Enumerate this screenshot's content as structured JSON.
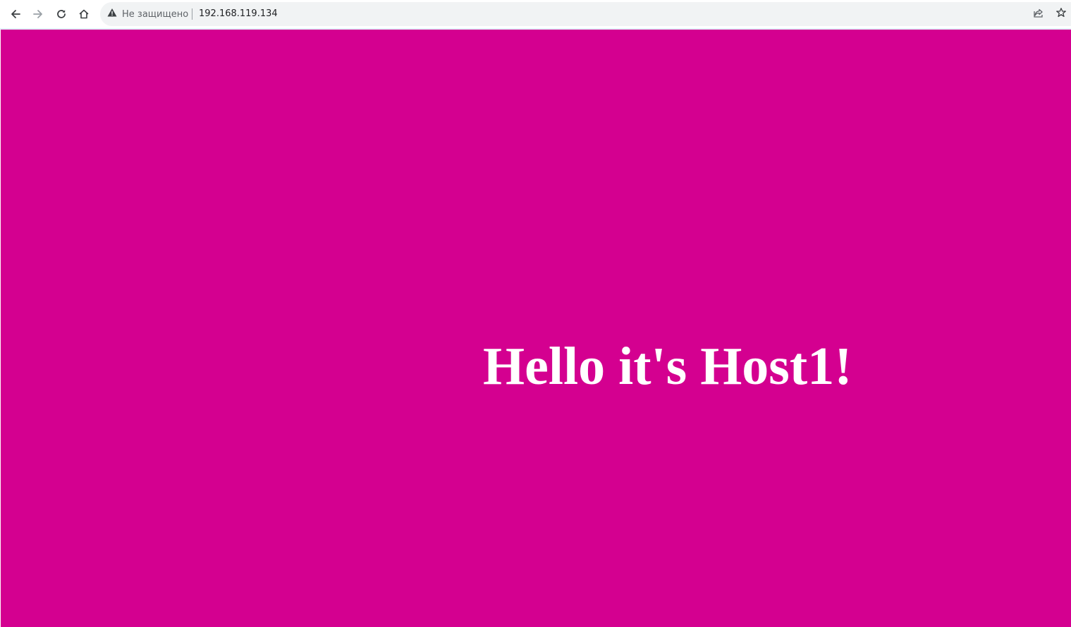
{
  "browser": {
    "toolbar": {
      "back_icon": "arrow-left-icon",
      "forward_icon": "arrow-right-icon",
      "reload_icon": "reload-icon",
      "home_icon": "home-icon"
    },
    "omnibox": {
      "security_icon": "warning-triangle-icon",
      "security_label": "Не защищено",
      "url": "192.168.119.134",
      "share_icon": "share-icon",
      "bookmark_icon": "star-icon"
    }
  },
  "page": {
    "heading": "Hello it's Host1!",
    "background_color": "#d40090",
    "text_color": "#ffffff"
  }
}
